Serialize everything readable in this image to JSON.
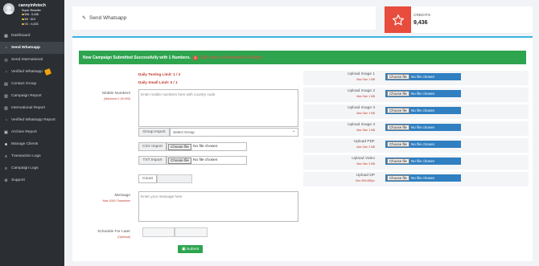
{
  "profile": {
    "name": "cannyinfotech",
    "role": "Super Reseller",
    "stats": [
      {
        "label": "WA : 9,436"
      },
      {
        "label": "WI : 513"
      },
      {
        "label": "VC : 4,433"
      }
    ]
  },
  "nav": {
    "items": [
      {
        "label": "Dashboard",
        "icon": "dashboard-icon"
      },
      {
        "label": "Send Whatsapp",
        "icon": "whatsapp-icon",
        "active": true
      },
      {
        "label": "Send International",
        "icon": "globe-icon"
      },
      {
        "label": "Verified Whatsapp",
        "icon": "whatsapp-icon"
      },
      {
        "label": "Contact Group",
        "icon": "contacts-icon"
      },
      {
        "label": "Campaign Report",
        "icon": "report-icon"
      },
      {
        "label": "International Report",
        "icon": "report-icon"
      },
      {
        "label": "Verified Whatsapp Report",
        "icon": "whatsapp-icon"
      },
      {
        "label": "Archive Report",
        "icon": "archive-icon"
      },
      {
        "label": "Manage Clients",
        "icon": "users-icon"
      },
      {
        "label": "Transaction Logs",
        "icon": "list-icon"
      },
      {
        "label": "Campaign Logs",
        "icon": "list-icon"
      },
      {
        "label": "Support",
        "icon": "support-icon"
      }
    ]
  },
  "header": {
    "title": "Send Whatsapp"
  },
  "credits": {
    "label": "CREDITS",
    "value": "9,436",
    "accent": "#e74c3c"
  },
  "alert": {
    "text": "Now Campaign Submitted Successfully with 1 Numbers.",
    "count": "1",
    "link": "Click here to Download Full Report"
  },
  "limits": {
    "testing": "Daily Testing Limit: 1 / 2",
    "small": "Daily Small Limit: 0 / 1"
  },
  "form": {
    "mobile_label": "Mobile Numbers",
    "mobile_sub": "(Maximum 1,00,000)",
    "mobile_placeholder": "Enter mobile numbers here with country code",
    "group_import_label": "Group Import",
    "group_select": "Select Group",
    "csv_import_label": "CSV Import",
    "txt_import_label": "TXT Import",
    "file_button": "Choose file",
    "file_status": "No file chosen",
    "count_label": "Count",
    "message_label": "Message",
    "message_sub": "Max 1000 Characters",
    "message_placeholder": "Enter your message here",
    "schedule_label": "Schedule For Later",
    "schedule_sub": "(Optional)",
    "submit_label": "Submit"
  },
  "uploads": [
    {
      "label": "Upload Image 1",
      "sub": "Max Size 1 MB"
    },
    {
      "label": "Upload Image 2",
      "sub": "Max Size 1 MB"
    },
    {
      "label": "Upload Image 3",
      "sub": "Max Size 1 MB"
    },
    {
      "label": "Upload Image 4",
      "sub": "Max Size 1 MB"
    },
    {
      "label": "Upload PDF",
      "sub": "Max Size 2 MB"
    },
    {
      "label": "Upload Video",
      "sub": "Max Size 3 MB"
    },
    {
      "label": "Upload DP",
      "sub": "Size 350x350px"
    }
  ],
  "colors": {
    "sidebar": "#2b2f33",
    "success": "#2ea44f",
    "danger": "#e74c3c",
    "upload_button": "#2f7fc1"
  }
}
